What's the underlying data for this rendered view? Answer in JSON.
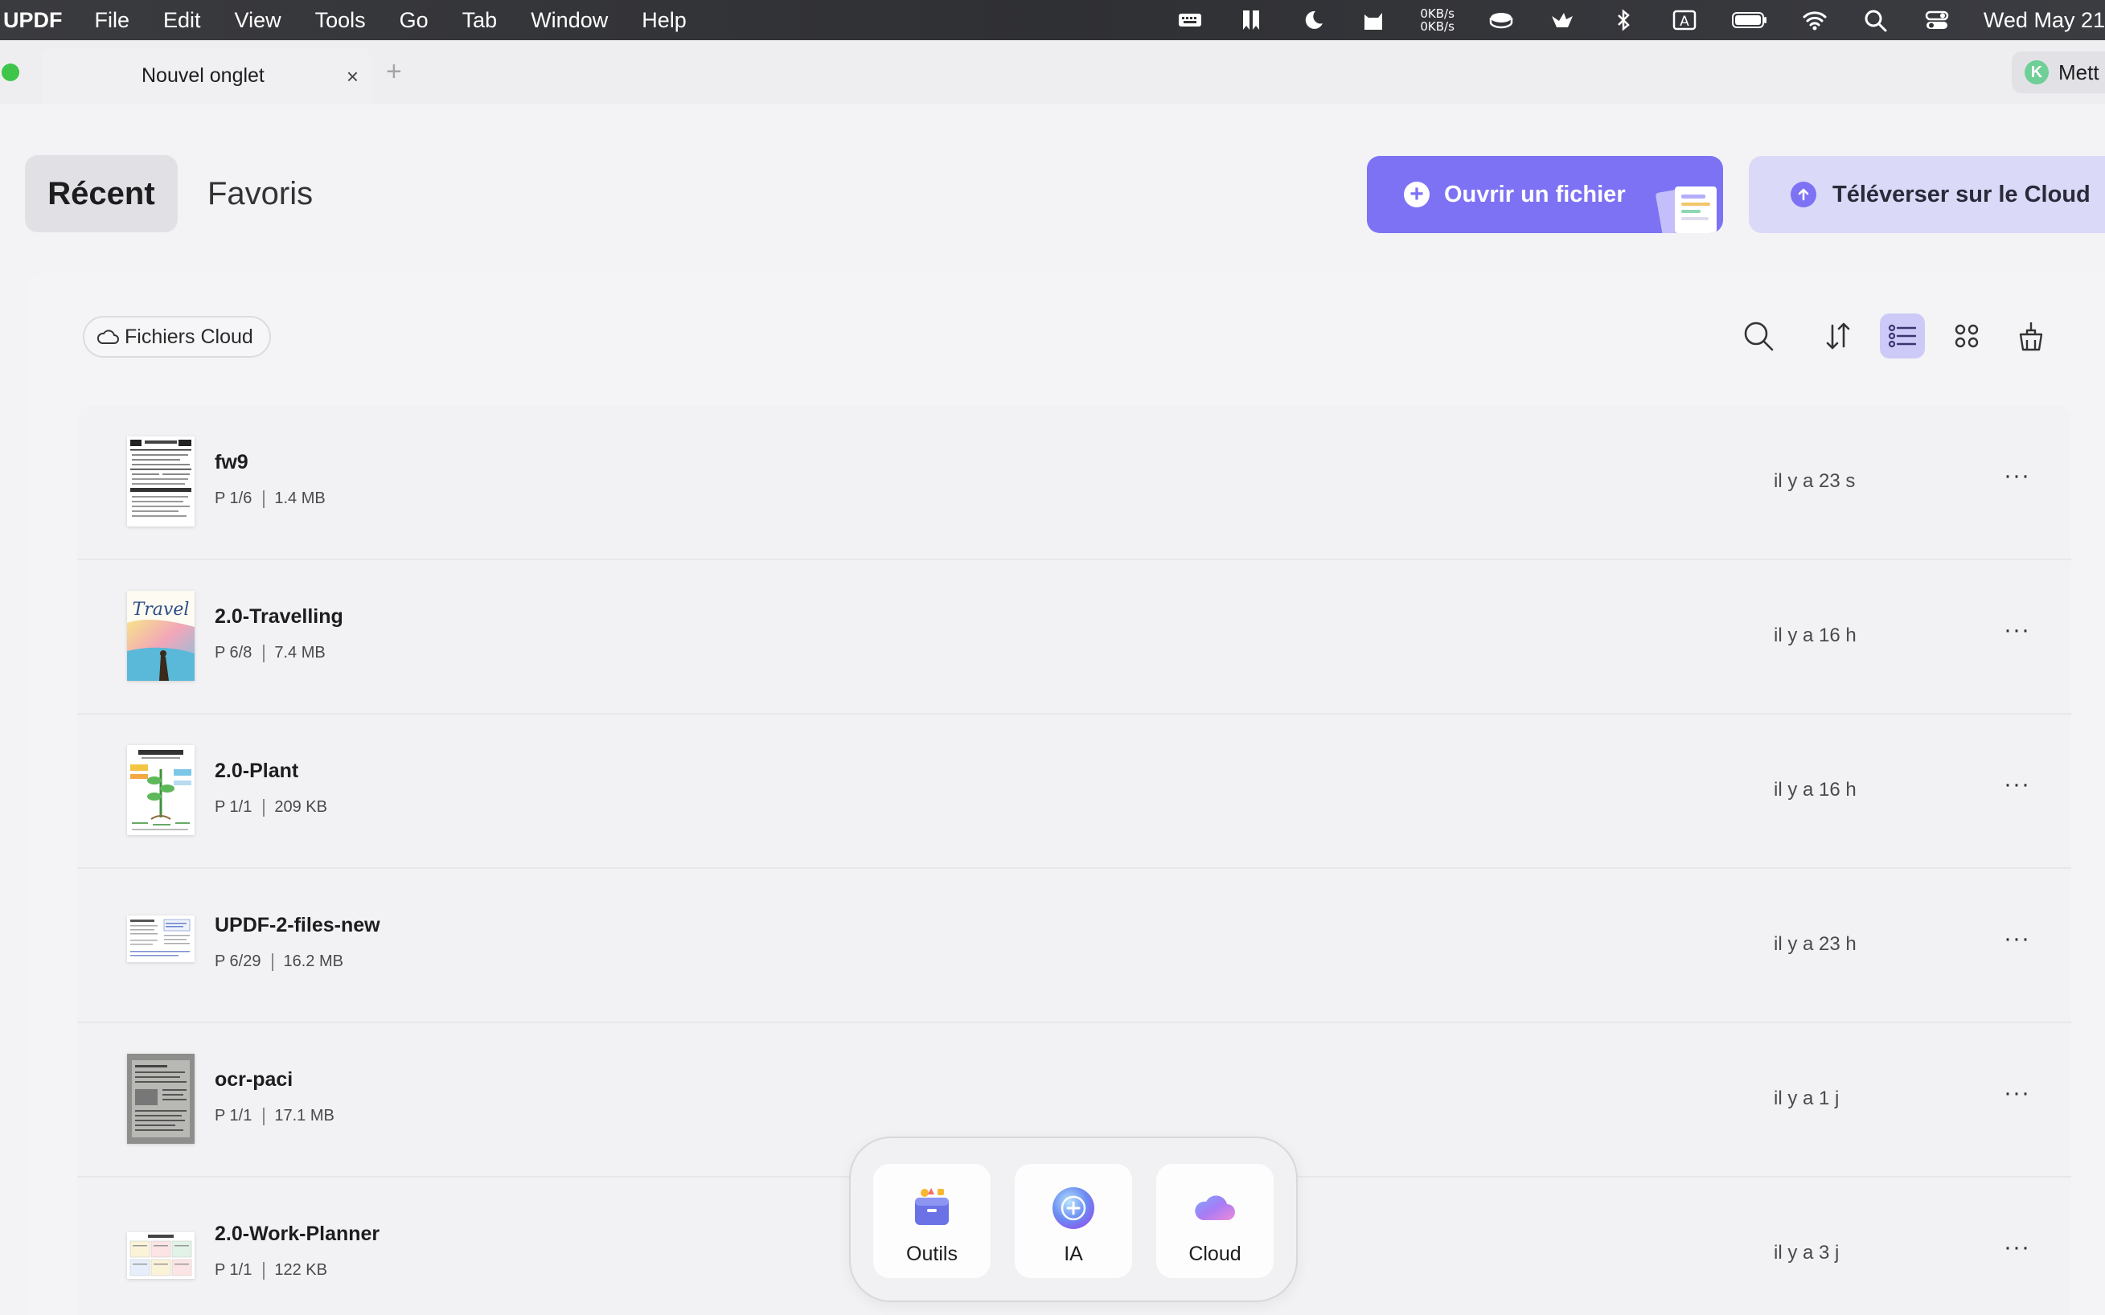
{
  "menubar": {
    "app_name": "UPDF",
    "menus": [
      "File",
      "Edit",
      "View",
      "Tools",
      "Go",
      "Tab",
      "Window",
      "Help"
    ],
    "status_icons": [
      "keyboard-icon",
      "bookmark-tool-icon",
      "moon-icon",
      "cat-icon",
      "disk-icon",
      "bird-icon",
      "bluetooth-icon",
      "input-method-icon",
      "battery-icon",
      "wifi-icon",
      "spotlight-search-icon",
      "control-center-icon"
    ],
    "net_up": "0KB/s",
    "net_down": "0KB/s",
    "input_method": "A",
    "clock": "Wed May 21"
  },
  "tabbar": {
    "tab_label": "Nouvel onglet",
    "close_glyph": "×",
    "add_glyph": "+",
    "account_initial": "K",
    "account_label": "Mett"
  },
  "header": {
    "tab_recent": "Récent",
    "tab_favorites": "Favoris",
    "open_file": "Ouvrir un fichier",
    "upload_cloud": "Téléverser sur le Cloud"
  },
  "toolbar": {
    "cloud_chip": "Fichiers Cloud",
    "icons": [
      "search-icon",
      "sort-icon",
      "list-view-icon",
      "grid-view-icon",
      "clean-icon"
    ],
    "active_view": "list"
  },
  "files": [
    {
      "name": "fw9",
      "pages": "P 1/6",
      "size": "1.4 MB",
      "time": "il y a 23 s",
      "more": "···"
    },
    {
      "name": "2.0-Travelling",
      "pages": "P 6/8",
      "size": "7.4 MB",
      "time": "il y a 16 h",
      "more": "···",
      "thumb_text": "Travel"
    },
    {
      "name": "2.0-Plant",
      "pages": "P 1/1",
      "size": "209 KB",
      "time": "il y a 16 h",
      "more": "···"
    },
    {
      "name": "UPDF-2-files-new",
      "pages": "P 6/29",
      "size": "16.2 MB",
      "time": "il y a 23 h",
      "more": "···"
    },
    {
      "name": "ocr-paci",
      "pages": "P 1/1",
      "size": "17.1 MB",
      "time": "il y a 1 j",
      "more": "···"
    },
    {
      "name": "2.0-Work-Planner",
      "pages": "P 1/1",
      "size": "122 KB",
      "time": "il y a 3 j",
      "more": "···"
    }
  ],
  "dock": {
    "tools": "Outils",
    "ai": "IA",
    "cloud": "Cloud"
  },
  "colors": {
    "accent": "#7d72f4",
    "accent_light": "#dad9f7",
    "traffic_green": "#3ec54a",
    "avatar_green": "#6fcf97"
  }
}
